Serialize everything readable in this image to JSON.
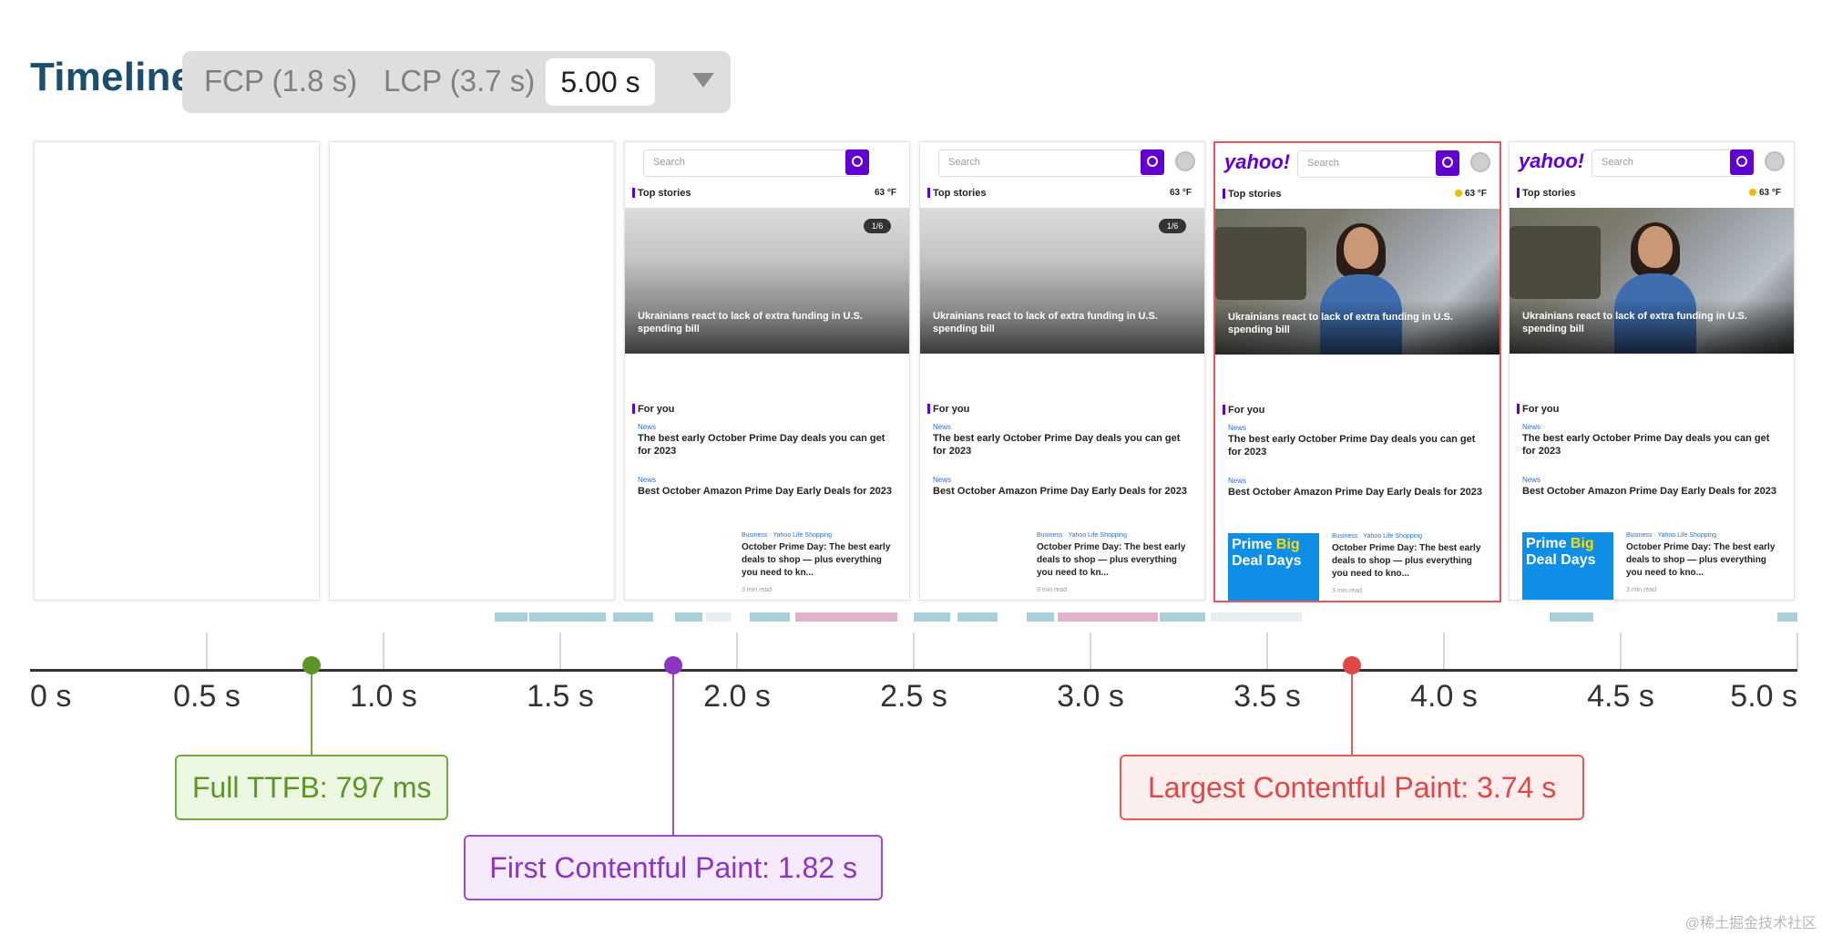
{
  "header": {
    "title": "Timeline",
    "fcp_option": "FCP (1.8 s)",
    "lcp_option": "LCP (3.7 s)",
    "selected_option": "5.00 s",
    "dropdown_icon": "caret-down-icon"
  },
  "filmstrip": {
    "frames": [
      {
        "state": "blank"
      },
      {
        "state": "blank"
      },
      {
        "state": "fcp",
        "search_placeholder": "Search",
        "section_top": "Top stories",
        "temperature": "63 °F",
        "image_counter": "1/6",
        "headline": "Ukrainians react to lack of extra funding in U.S. spending bill",
        "section_for_you": "For you",
        "news1_tag": "News",
        "news1_title": "The best early October Prime Day deals you can get for 2023",
        "news2_tag": "News",
        "news2_title": "Best October Amazon Prime Day Early Deals for 2023",
        "card_meta": "Business · Yahoo Life Shopping",
        "card_title": "October Prime Day: The best early deals to shop — plus everything you need to kn...",
        "card_read": "3 min read"
      },
      {
        "state": "fcp",
        "search_placeholder": "Search",
        "section_top": "Top stories",
        "temperature": "63 °F",
        "image_counter": "1/6",
        "headline": "Ukrainians react to lack of extra funding in U.S. spending bill",
        "section_for_you": "For you",
        "news1_tag": "News",
        "news1_title": "The best early October Prime Day deals you can get for 2023",
        "news2_tag": "News",
        "news2_title": "Best October Amazon Prime Day Early Deals for 2023",
        "card_meta": "Business · Yahoo Life Shopping",
        "card_title": "October Prime Day: The best early deals to shop — plus everything you need to kn...",
        "card_read": "3 min read"
      },
      {
        "state": "lcp",
        "logo": "yahoo!",
        "search_placeholder": "Search",
        "section_top": "Top stories",
        "temperature": "63 °F",
        "headline": "Ukrainians react to lack of extra funding in U.S. spending bill",
        "section_for_you": "For you",
        "news1_tag": "News",
        "news1_title": "The best early October Prime Day deals you can get for 2023",
        "news2_tag": "News",
        "news2_title": "Best October Amazon Prime Day Early Deals for 2023",
        "thumb_line1a": "Prime",
        "thumb_line1b": "Big",
        "thumb_line2": "Deal Days",
        "card_meta": "Business · Yahoo Life Shopping",
        "card_title": "October Prime Day: The best early deals to shop — plus everything you need to kno...",
        "card_read": "3 min read"
      },
      {
        "state": "complete",
        "logo": "yahoo!",
        "search_placeholder": "Search",
        "section_top": "Top stories",
        "temperature": "63 °F",
        "headline": "Ukrainians react to lack of extra funding in U.S. spending bill",
        "section_for_you": "For you",
        "news1_tag": "News",
        "news1_title": "The best early October Prime Day deals you can get for 2023",
        "news2_tag": "News",
        "news2_title": "Best October Amazon Prime Day Early Deals for 2023",
        "thumb_line1a": "Prime",
        "thumb_line1b": "Big",
        "thumb_line2": "Deal Days",
        "card_meta": "Business · Yahoo Life Shopping",
        "card_title": "October Prime Day: The best early deals to shop — plus everything you need to kno...",
        "card_read": "3 min read"
      }
    ]
  },
  "timeline": {
    "ticks": [
      "0 s",
      "0.5 s",
      "1.0 s",
      "1.5 s",
      "2.0 s",
      "2.5 s",
      "3.0 s",
      "3.5 s",
      "4.0 s",
      "4.5 s",
      "5.0 s"
    ],
    "markers": [
      {
        "id": "ttfb",
        "time_s": 0.797,
        "label": "Full TTFB: 797 ms",
        "color": "#5d9428"
      },
      {
        "id": "fcp",
        "time_s": 1.82,
        "label": "First Contentful Paint: 1.82 s",
        "color": "#8a36c1"
      },
      {
        "id": "lcp",
        "time_s": 3.74,
        "label": "Largest Contentful Paint: 3.74 s",
        "color": "#e04848"
      }
    ],
    "activity_colors": {
      "teal": "#a9cfd8",
      "pink": "#e0b4cc",
      "light": "#e6eef0"
    }
  },
  "watermark": "@稀土掘金技术社区"
}
